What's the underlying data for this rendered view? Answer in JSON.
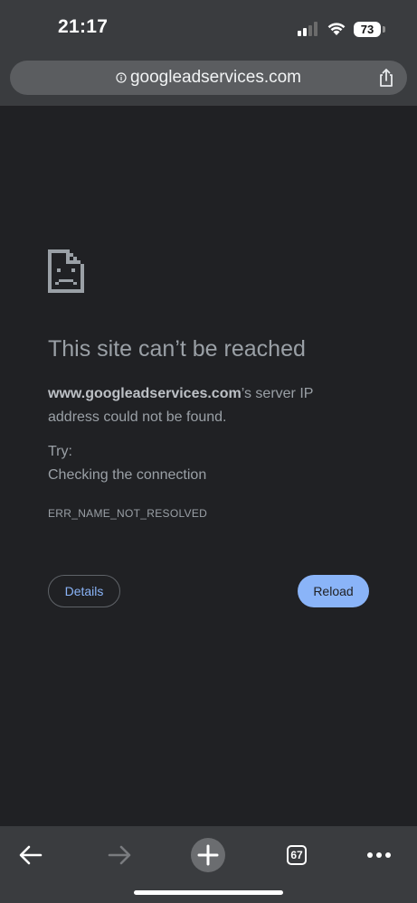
{
  "status_bar": {
    "time": "21:17",
    "battery_level": "73"
  },
  "address_bar": {
    "url": "googleadservices.com"
  },
  "error_page": {
    "title": "This site can’t be reached",
    "description_bold": "www.googleadservices.com",
    "description_text": "’s server IP address could not be found.",
    "try_label": "Try:",
    "suggestion": "Checking the connection",
    "error_code": "ERR_NAME_NOT_RESOLVED",
    "details_label": "Details",
    "reload_label": "Reload"
  },
  "toolbar": {
    "tab_count": "67",
    "icons": {
      "back": "back-arrow-icon",
      "forward": "forward-arrow-icon",
      "new_tab": "plus-icon",
      "tabs": "tab-switcher-icon",
      "menu": "more-dots-icon"
    }
  },
  "colors": {
    "background": "#202124",
    "chrome_bar": "#3a3c3f",
    "url_pill": "#5b5d60",
    "accent": "#8ab4f8",
    "muted_text": "#9aa0a6"
  }
}
